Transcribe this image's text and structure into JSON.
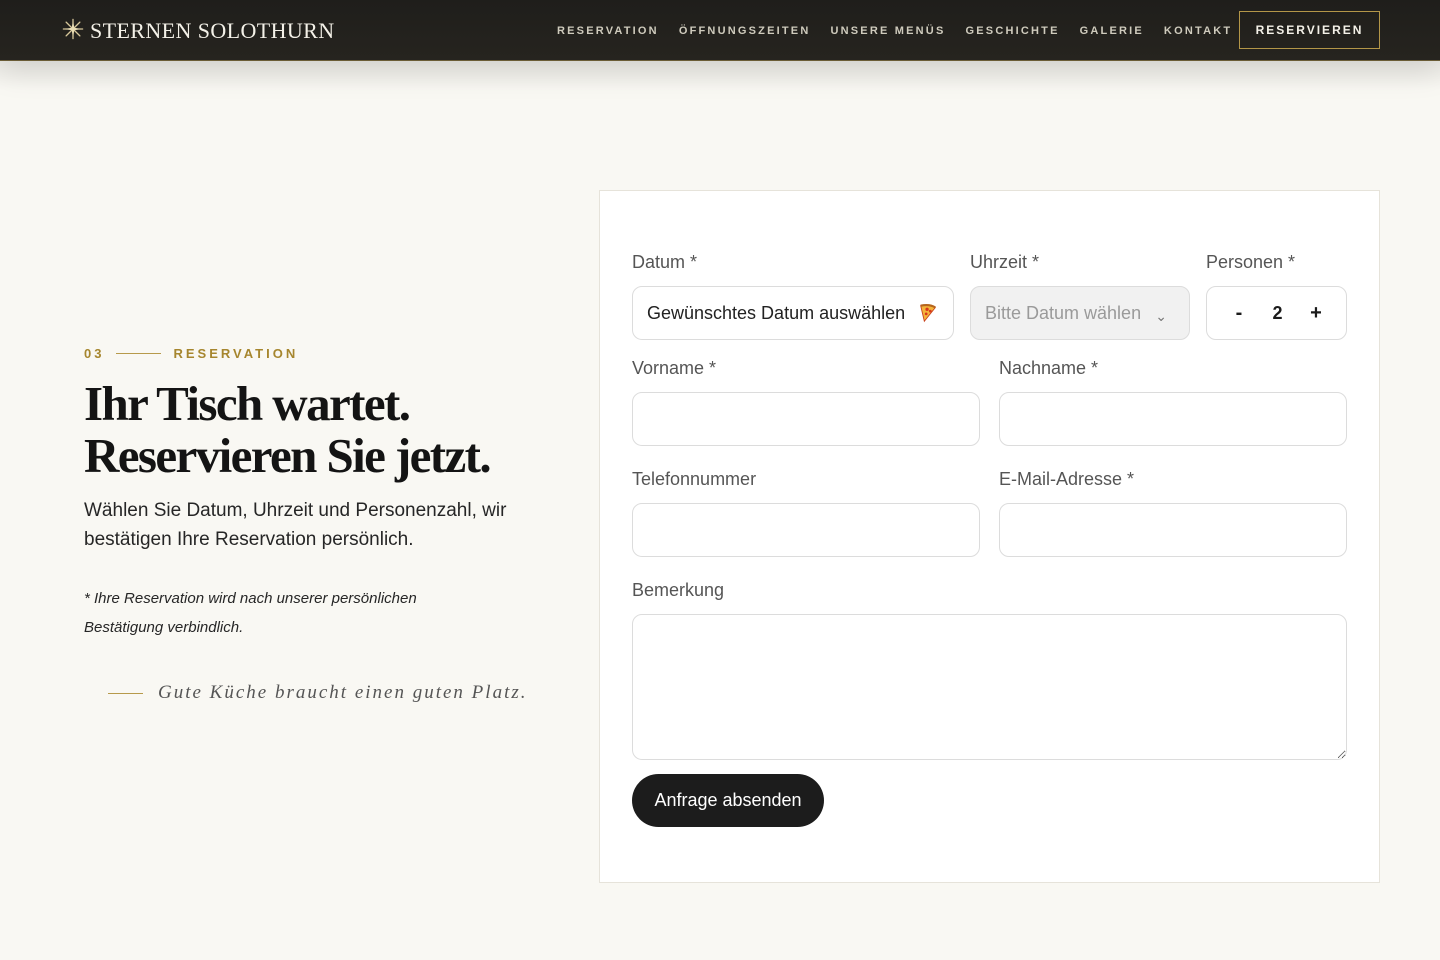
{
  "header": {
    "brand": "STERNEN SOLOTHURN",
    "nav": [
      "RESERVATION",
      "ÖFFNUNGSZEITEN",
      "UNSERE MENÜS",
      "GESCHICHTE",
      "GALERIE",
      "KONTAKT"
    ],
    "cta": "RESERVIEREN"
  },
  "intro": {
    "number": "03",
    "eyebrow": "RESERVATION",
    "headline_1": "Ihr Tisch wartet.",
    "headline_2": "Reservieren Sie jetzt.",
    "lead": "Wählen Sie Datum, Uhrzeit und Personenzahl, wir bestätigen Ihre Reservation persönlich.",
    "note": "* Ihre Reservation wird nach unserer persönlichen Bestätigung verbindlich.",
    "quote": "Gute Küche braucht einen guten Platz."
  },
  "form": {
    "date_label": "Datum *",
    "date_value": "Gewünschtes Datum auswählen",
    "date_icon": "pizza-slice-icon",
    "time_label": "Uhrzeit *",
    "time_placeholder": "Bitte Datum wählen",
    "persons_label": "Personen *",
    "persons_minus": "-",
    "persons_value": "2",
    "persons_plus": "+",
    "firstname_label": "Vorname *",
    "firstname_value": "",
    "lastname_label": "Nachname *",
    "lastname_value": "",
    "phone_label": "Telefonnummer",
    "phone_value": "",
    "email_label": "E-Mail-Adresse *",
    "email_value": "",
    "remark_label": "Bemerkung",
    "remark_value": "",
    "submit": "Anfrage absenden"
  },
  "colors": {
    "header_bg": "#1f1e1b",
    "accent_gold": "#a6862e",
    "page_bg": "#f9f8f3",
    "button_dark": "#1c1c1c"
  }
}
